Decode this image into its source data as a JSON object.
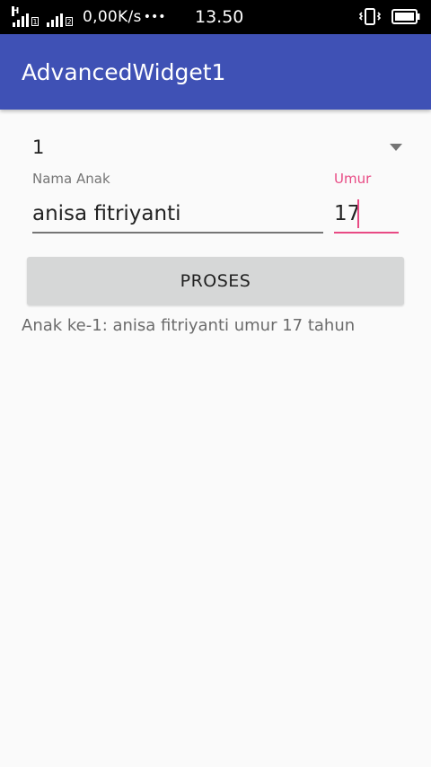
{
  "status_bar": {
    "network_type": "H",
    "sim1_badge": "1",
    "sim2_badge": "2",
    "speed": "0,00K/s",
    "dots": "•••",
    "time": "13.50",
    "icons": [
      "signal-icon",
      "signal-icon",
      "vibrate-icon",
      "battery-icon"
    ]
  },
  "app_bar": {
    "title": "AdvancedWidget1",
    "color": "#3f51b5"
  },
  "form": {
    "spinner_value": "1",
    "nama_label": "Nama Anak",
    "nama_value": "anisa fitriyanti",
    "umur_label": "Umur",
    "umur_value": "17",
    "accent_color": "#e84a84"
  },
  "button": {
    "label": "PROSES"
  },
  "result": {
    "text": "Anak ke-1: anisa fitriyanti umur 17 tahun"
  }
}
